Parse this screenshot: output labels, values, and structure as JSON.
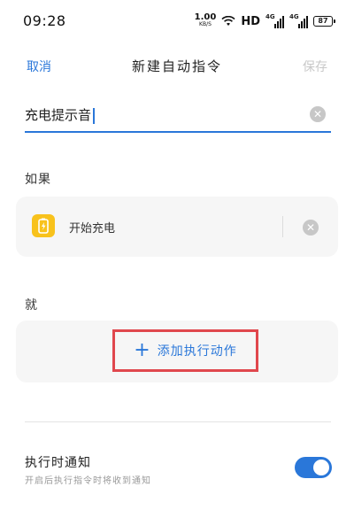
{
  "status_bar": {
    "time": "09:28",
    "net_speed": "1.00",
    "net_speed_unit": "KB/S",
    "hd": "HD",
    "signal1_label": "4G",
    "signal2_label": "4G",
    "battery": "87"
  },
  "nav": {
    "cancel": "取消",
    "title": "新建自动指令",
    "save": "保存"
  },
  "name_input": {
    "value": "充电提示音"
  },
  "if_section": {
    "label": "如果",
    "trigger": "开始充电"
  },
  "then_section": {
    "label": "就",
    "add_action": "添加执行动作"
  },
  "notify": {
    "title": "执行时通知",
    "description": "开启后执行指令时将收到通知",
    "enabled": true
  },
  "colors": {
    "accent": "#2a77d9",
    "highlight_box": "#e0474d",
    "trigger_icon_bg": "#f8c21c"
  }
}
